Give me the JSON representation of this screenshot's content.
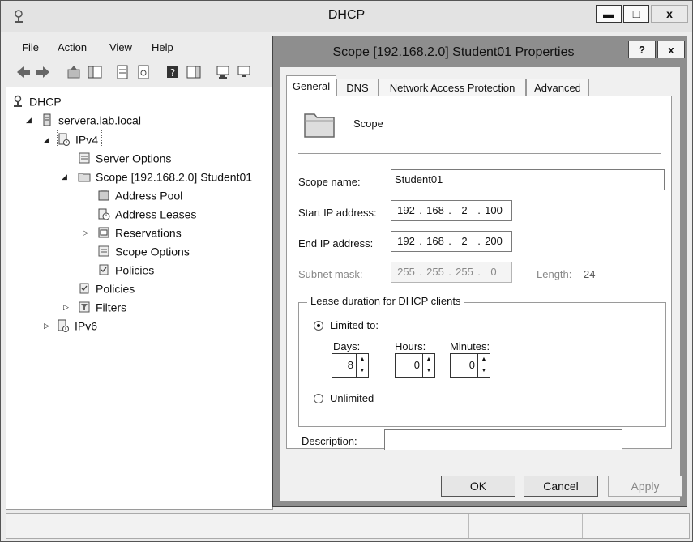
{
  "window": {
    "title": "DHCP"
  },
  "window_controls": {
    "minimize": "▬",
    "maximize": "□",
    "close": "x"
  },
  "menu": [
    "File",
    "Action",
    "View",
    "Help"
  ],
  "tree": {
    "root": "DHCP",
    "server": "servera.lab.local",
    "ipv4": "IPv4",
    "server_options": "Server Options",
    "scope": "Scope [192.168.2.0] Student01",
    "address_pool": "Address Pool",
    "address_leases": "Address Leases",
    "reservations": "Reservations",
    "scope_options": "Scope Options",
    "scope_policies": "Policies",
    "policies": "Policies",
    "filters": "Filters",
    "ipv6": "IPv6"
  },
  "dialog": {
    "title": "Scope [192.168.2.0] Student01 Properties",
    "help_label": "?",
    "close_label": "x",
    "tabs": [
      "General",
      "DNS",
      "Network Access Protection",
      "Advanced"
    ],
    "active_tab": "General",
    "header_label": "Scope",
    "scope_name_label": "Scope name:",
    "scope_name_value": "Student01",
    "start_ip_label": "Start IP address:",
    "start_ip": [
      "192",
      "168",
      "2",
      "100"
    ],
    "end_ip_label": "End IP address:",
    "end_ip": [
      "192",
      "168",
      "2",
      "200"
    ],
    "subnet_label": "Subnet mask:",
    "subnet": [
      "255",
      "255",
      "255",
      "0"
    ],
    "length_label": "Length:",
    "length_value": "24",
    "lease_group_label": "Lease duration for DHCP clients",
    "limited_label": "Limited to:",
    "days_label": "Days:",
    "days_value": "8",
    "hours_label": "Hours:",
    "hours_value": "0",
    "minutes_label": "Minutes:",
    "minutes_value": "0",
    "unlimited_label": "Unlimited",
    "lease_mode": "limited",
    "description_label": "Description:",
    "description_value": "",
    "ok_label": "OK",
    "cancel_label": "Cancel",
    "apply_label": "Apply"
  }
}
